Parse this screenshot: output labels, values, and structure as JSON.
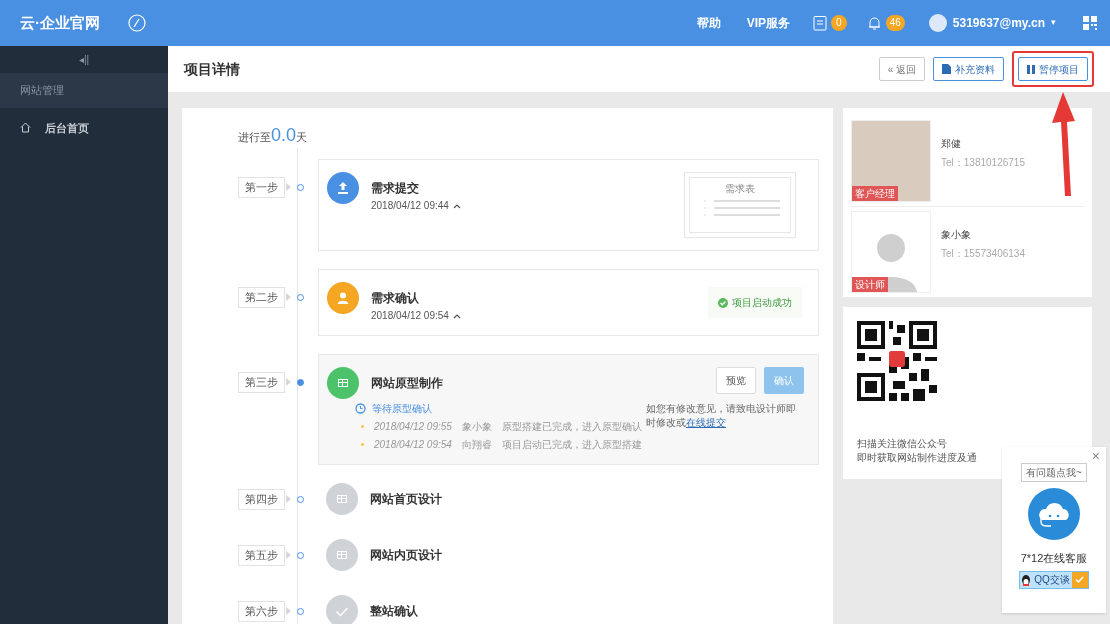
{
  "topbar": {
    "logo": "云·企业官网",
    "links": [
      "帮助",
      "VIP服务"
    ],
    "task_badge": "0",
    "bell_badge": "46",
    "user": "5319637@my.cn",
    "caret": "▾"
  },
  "sidebar": {
    "toggle": "◂||",
    "section": "网站管理",
    "items": [
      {
        "label": "后台首页",
        "selected": false
      }
    ]
  },
  "header": {
    "title": "项目详情",
    "buttons": [
      {
        "kind": "back",
        "label": "« 返回",
        "highlighted": false
      },
      {
        "kind": "doc",
        "label": "补充资料",
        "highlighted": false
      },
      {
        "kind": "pause",
        "label": "暂停项目",
        "highlighted": true
      }
    ]
  },
  "progress": {
    "prefix": "进行至",
    "value": "0.0",
    "suffix": "天"
  },
  "steps": [
    {
      "kind": "form",
      "step": "第一步",
      "title": "需求提交",
      "time": "2018/04/12 09:44",
      "current": false,
      "color": "#4a90e2",
      "form_title": "需求表"
    },
    {
      "kind": "badge",
      "step": "第二步",
      "title": "需求确认",
      "time": "2018/04/12 09:54",
      "current": false,
      "color": "#f5a623",
      "badge": "项目启动成功"
    },
    {
      "kind": "actions",
      "step": "第三步",
      "title": "网站原型制作",
      "current": true,
      "color": "#4cc26b",
      "status": "等待原型确认",
      "buttons": [
        "预览",
        "确认"
      ],
      "note": "如您有修改意见，请致电设计师即时修改或",
      "link": "在线提交",
      "logs": [
        {
          "time": "2018/04/12 09:55",
          "who": "象小象",
          "text": "原型搭建已完成，进入原型确认"
        },
        {
          "time": "2018/04/12 09:54",
          "who": "向翔睿",
          "text": "项目启动已完成，进入原型搭建"
        }
      ]
    },
    {
      "kind": "plain",
      "step": "第四步",
      "title": "网站首页设计",
      "current": false,
      "color": "#cfd3d8"
    },
    {
      "kind": "plain",
      "step": "第五步",
      "title": "网站内页设计",
      "current": false,
      "color": "#cfd3d8"
    },
    {
      "kind": "plain",
      "step": "第六步",
      "title": "整站确认",
      "current": false,
      "color": "#cfd3d8"
    }
  ],
  "people": [
    {
      "kind": "photo",
      "name": "郑健",
      "tel": "Tel：13810126715",
      "role": "客户经理"
    },
    {
      "kind": "avatar",
      "name": "象小象",
      "tel": "Tel：15573406134",
      "role": "设计师"
    }
  ],
  "qr": {
    "lines": [
      "扫描关注微信公众号",
      "即时获取网站制作进度及通"
    ]
  },
  "chat": {
    "close": "×",
    "bubble": "有问题点我~",
    "title": "7*12在线客服",
    "qq": "QQ交谈"
  }
}
